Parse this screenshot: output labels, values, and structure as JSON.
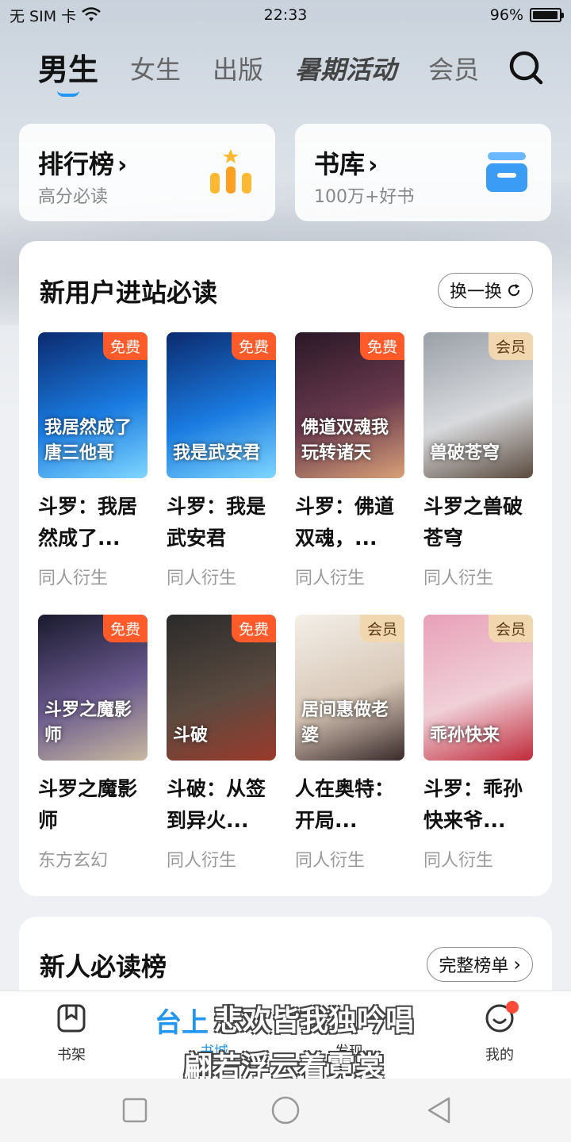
{
  "status_bar": {
    "carrier": "无 SIM 卡",
    "time": "22:33",
    "battery": "96%",
    "battery_level": 0.96
  },
  "tabs": [
    {
      "label": "男生",
      "active": true
    },
    {
      "label": "女生"
    },
    {
      "label": "出版"
    },
    {
      "label": "暑期活动"
    },
    {
      "label": "会员"
    }
  ],
  "quick": {
    "rank": {
      "title": "排行榜",
      "arrow": "›",
      "subtitle": "高分必读"
    },
    "library": {
      "title": "书库",
      "arrow": "›",
      "subtitle": "100万+好书"
    }
  },
  "section1": {
    "title": "新用户进站必读",
    "refresh_label": "换一换",
    "books": [
      {
        "name": "斗罗：我居然成了...",
        "category": "同人衍生",
        "badge": "免费",
        "badge_type": "free",
        "cover_text": "我居然成了唐三他哥",
        "cover_colors": [
          "#0b2a6e",
          "#1a7be0",
          "#7fd6ff"
        ]
      },
      {
        "name": "斗罗：我是武安君",
        "category": "同人衍生",
        "badge": "免费",
        "badge_type": "free",
        "cover_text": "我是武安君",
        "cover_colors": [
          "#0b2a6e",
          "#1a7be0",
          "#7fd6ff"
        ]
      },
      {
        "name": "斗罗：佛道双魂，...",
        "category": "同人衍生",
        "badge": "免费",
        "badge_type": "free",
        "cover_text": "佛道双魂我玩转诸天",
        "cover_colors": [
          "#2a1826",
          "#6a3a4e",
          "#d8a078"
        ]
      },
      {
        "name": "斗罗之兽破苍穹",
        "category": "同人衍生",
        "badge": "会员",
        "badge_type": "vip",
        "cover_text": "兽破苍穹",
        "cover_colors": [
          "#9aa0a8",
          "#d8dadd",
          "#5a4a3e"
        ]
      },
      {
        "name": "斗罗之魔影师",
        "category": "东方玄幻",
        "badge": "免费",
        "badge_type": "free",
        "cover_text": "斗罗之魔影师",
        "cover_colors": [
          "#1a1a2e",
          "#6a5a8e",
          "#c8b8a0"
        ]
      },
      {
        "name": "斗破：从签到异火...",
        "category": "同人衍生",
        "badge": "免费",
        "badge_type": "free",
        "cover_text": "斗破",
        "cover_colors": [
          "#2a2a2a",
          "#5a4a40",
          "#9a3a2a"
        ]
      },
      {
        "name": "人在奥特：开局...",
        "category": "同人衍生",
        "badge": "会员",
        "badge_type": "vip",
        "cover_text": "居间惠做老婆",
        "cover_colors": [
          "#f4efe8",
          "#d8c8b8",
          "#3a2a2a"
        ]
      },
      {
        "name": "斗罗：乖孙快来爷...",
        "category": "同人衍生",
        "badge": "会员",
        "badge_type": "vip",
        "cover_text": "乖孙快来",
        "cover_colors": [
          "#e8a0b8",
          "#f0d0d8",
          "#c02a3a"
        ]
      }
    ]
  },
  "section2": {
    "title": "新人必读榜",
    "full_list_label": "完整榜单"
  },
  "bottom_nav": {
    "shelf": "书架",
    "store_logo": "台上",
    "store": "书城",
    "discover": "发现",
    "me": "我的"
  },
  "overlay": {
    "line1": "悲欢皆我独吟唱",
    "line2": "翩若浮云着霓裳"
  },
  "colors": {
    "accent": "#2196f3",
    "free_badge": "#ff5a2a",
    "vip_badge": "#f1d7b0"
  }
}
